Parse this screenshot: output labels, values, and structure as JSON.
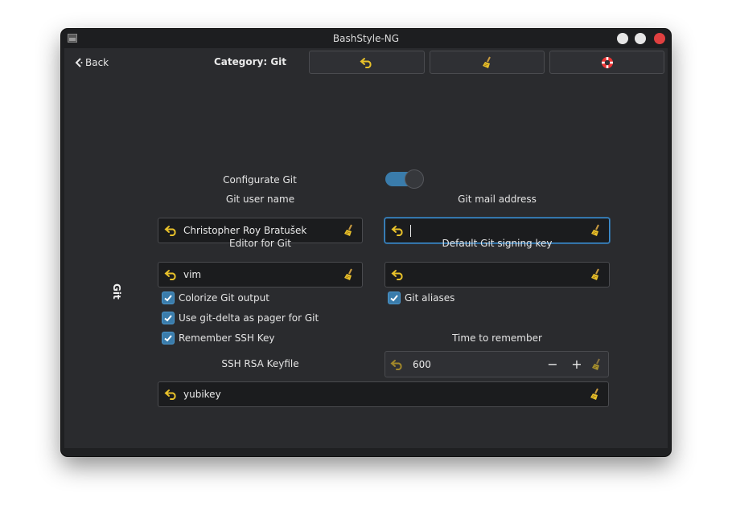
{
  "window": {
    "title": "BashStyle-NG"
  },
  "header": {
    "back_label": "Back",
    "category_label": "Category: Git"
  },
  "sidebar": {
    "vertical_label": "Git"
  },
  "git": {
    "configure_label": "Configurate Git",
    "configure_enabled": true,
    "user_name_label": "Git user name",
    "user_name_value": "Christopher Roy Bratušek",
    "mail_label": "Git mail address",
    "mail_value": "",
    "editor_label": "Editor for Git",
    "editor_value": "vim",
    "signing_key_label": "Default Git signing key",
    "signing_key_value": "",
    "colorize_label": "Colorize Git output",
    "colorize_checked": true,
    "aliases_label": "Git aliases",
    "aliases_checked": true,
    "delta_label": "Use git-delta as pager for Git",
    "delta_checked": true,
    "remember_ssh_label": "Remember SSH Key",
    "remember_ssh_checked": true,
    "time_label": "Time to remember",
    "time_value": "600",
    "time_minus": "−",
    "time_plus": "+",
    "ssh_keyfile_label": "SSH RSA Keyfile",
    "ssh_keyfile_value": "yubikey"
  },
  "colors": {
    "accent": "#3a7cab",
    "undo_icon": "#e8c12a",
    "close_button": "#e04040"
  },
  "icons": {
    "undo": "undo-arrow-icon",
    "clear": "broom-icon",
    "help": "lifebuoy-icon",
    "back": "chevron-left-icon"
  }
}
